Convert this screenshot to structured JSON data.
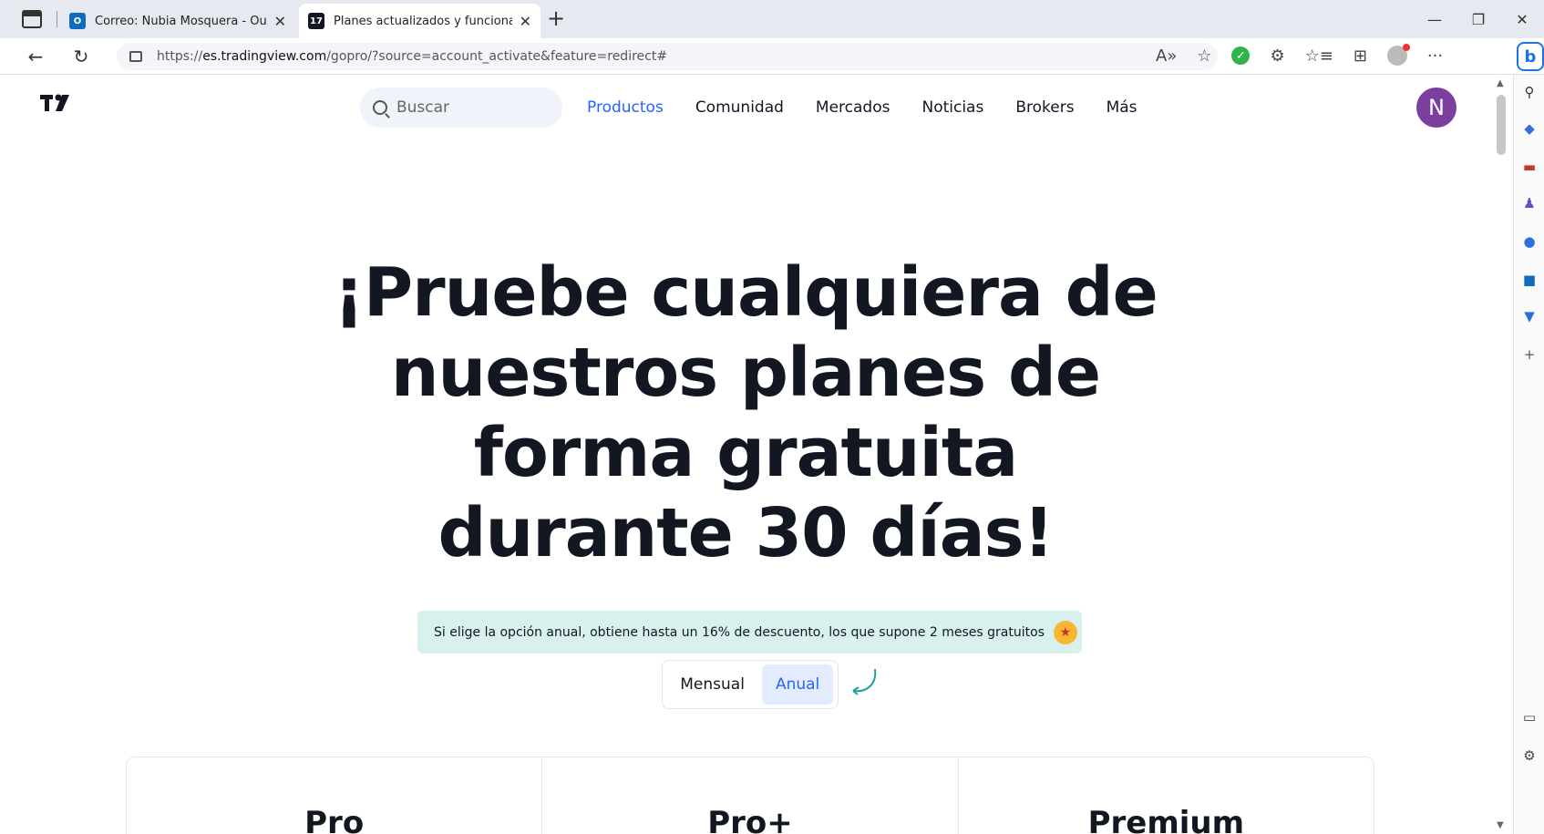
{
  "browser": {
    "tabs": [
      {
        "title": "Correo: Nubia Mosquera - Outlo",
        "active": false,
        "icon": "outlook-icon"
      },
      {
        "title": "Planes actualizados y funcionalid",
        "active": true,
        "icon": "tradingview-icon"
      }
    ],
    "new_tab_symbol": "+",
    "controls": {
      "minimize": "—",
      "restore": "❐",
      "close": "✕"
    },
    "nav": {
      "back": "←",
      "reload": "↻"
    },
    "url_prefix": "https://",
    "url_host": "es.tradingview.com",
    "url_path": "/gopro/?source=account_activate&feature=redirect#",
    "read_aloud": "A»",
    "favorite_add": "☆",
    "extension_check": "✓",
    "extensions": "⚙",
    "favorites": "☆≡",
    "collections": "⊞",
    "more": "···",
    "bing": "b"
  },
  "site": {
    "logo": "TV",
    "search_placeholder": "Buscar",
    "nav": [
      {
        "label": "Productos",
        "active": true
      },
      {
        "label": "Comunidad",
        "active": false
      },
      {
        "label": "Mercados",
        "active": false
      },
      {
        "label": "Noticias",
        "active": false
      },
      {
        "label": "Brokers",
        "active": false
      },
      {
        "label": "Más",
        "active": false
      }
    ],
    "avatar_letter": "N",
    "accent": "#2962ff"
  },
  "hero": {
    "lines": [
      "¡Pruebe cualquiera de",
      "nuestros planes de",
      "forma gratuita",
      "durante 30 días!"
    ]
  },
  "promo": {
    "text": "Si elige la opción anual, obtiene hasta un 16% de descuento, los que supone 2 meses gratuitos",
    "emoji": "star-struck-emoji"
  },
  "billing_toggle": {
    "monthly": "Mensual",
    "annual": "Anual",
    "selected": "Anual"
  },
  "plans": [
    "Pro",
    "Pro+",
    "Premium"
  ]
}
